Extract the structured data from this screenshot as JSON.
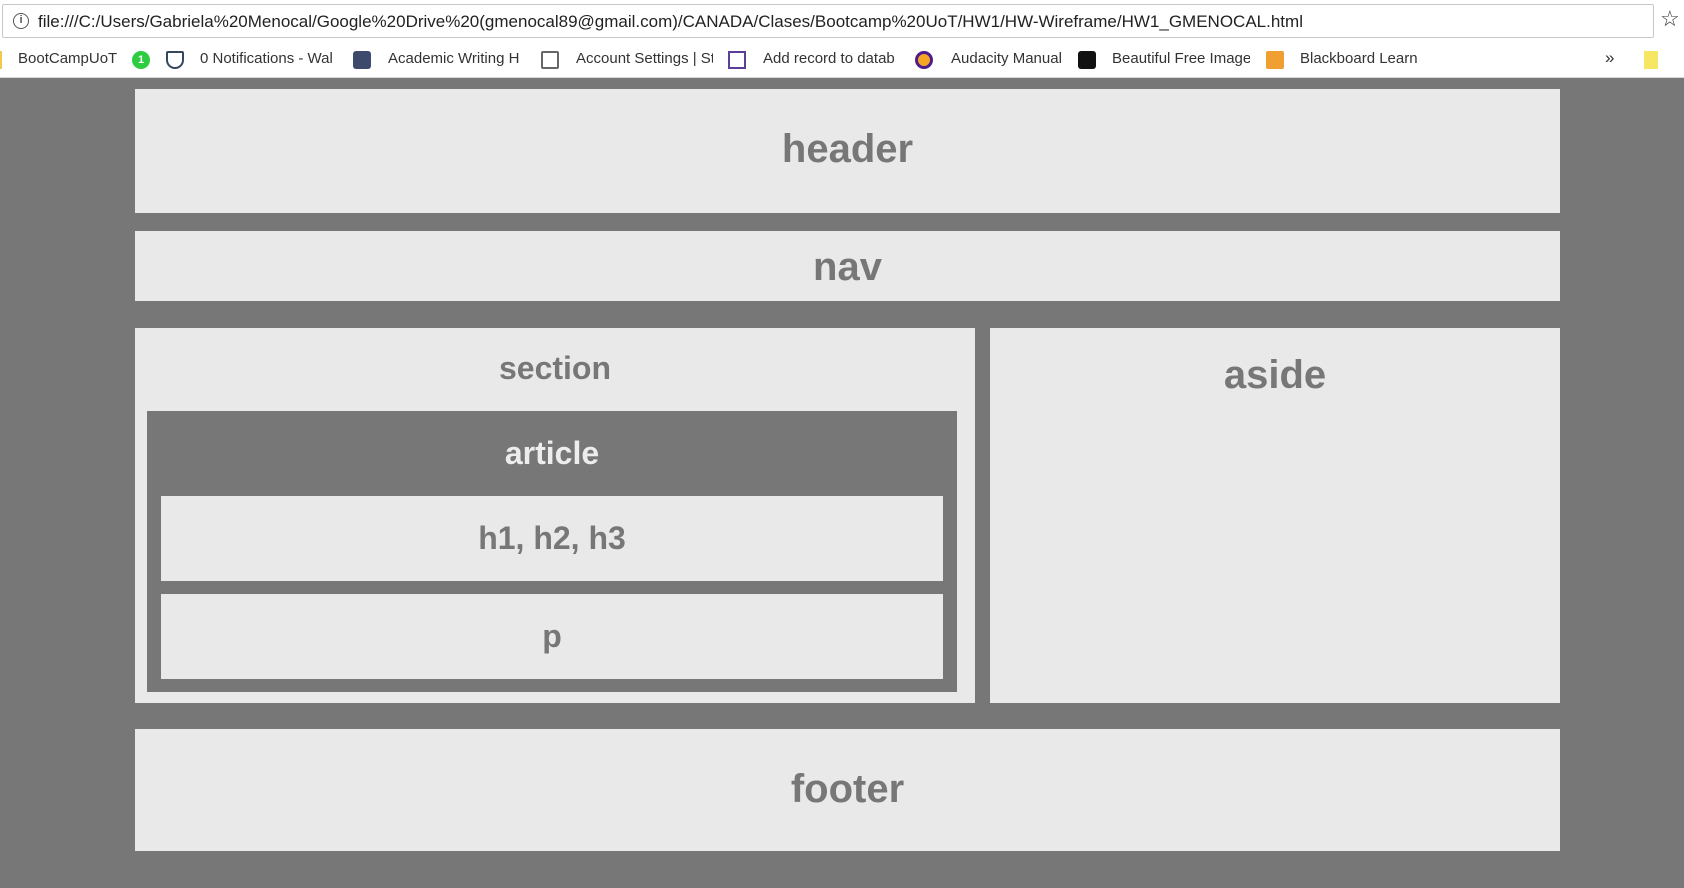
{
  "browser": {
    "url": "file:///C:/Users/Gabriela%20Menocal/Google%20Drive%20(gmenocal89@gmail.com)/CANADA/Clases/Bootcamp%20UoT/HW1/HW-Wireframe/HW1_GMENOCAL.html",
    "bookmarks": [
      {
        "label": "BootCampUoT",
        "icon": "folder-icon"
      },
      {
        "label": "0 Notifications - Wal",
        "icon": "badge-icon"
      },
      {
        "label": "Academic Writing H",
        "icon": "cloud-icon"
      },
      {
        "label": "Account Settings | St",
        "icon": "university-icon"
      },
      {
        "label": "Add record to datab",
        "icon": "database-icon"
      },
      {
        "label": "Audacity Manual",
        "icon": "headphones-icon"
      },
      {
        "label": "Beautiful Free Image",
        "icon": "camera-icon"
      },
      {
        "label": "Blackboard Learn",
        "icon": "pencil-icon"
      }
    ],
    "badge_count": "1",
    "more_label": "»"
  },
  "wireframe": {
    "header": "header",
    "nav": "nav",
    "section": "section",
    "article": "article",
    "headings": "h1, h2, h3",
    "paragraph": "p",
    "aside": "aside",
    "footer": "footer"
  },
  "colors": {
    "background": "#777777",
    "box": "#e9e9e9",
    "text": "#777777"
  }
}
